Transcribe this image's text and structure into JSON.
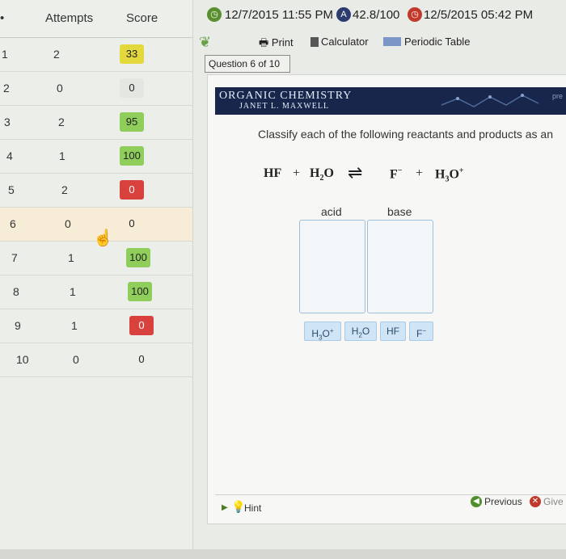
{
  "scores": {
    "headers": {
      "attempts": "Attempts",
      "score": "Score"
    },
    "rows": [
      {
        "num": "1",
        "attempts": "2",
        "score": "33",
        "status": "yellow"
      },
      {
        "num": "2",
        "attempts": "0",
        "score": "0",
        "status": "gray"
      },
      {
        "num": "3",
        "attempts": "2",
        "score": "95",
        "status": "green"
      },
      {
        "num": "4",
        "attempts": "1",
        "score": "100",
        "status": "green"
      },
      {
        "num": "5",
        "attempts": "2",
        "score": "0",
        "status": "red"
      },
      {
        "num": "6",
        "attempts": "0",
        "score": "0",
        "status": "gray"
      },
      {
        "num": "7",
        "attempts": "1",
        "score": "100",
        "status": "green"
      },
      {
        "num": "8",
        "attempts": "1",
        "score": "100",
        "status": "green"
      },
      {
        "num": "9",
        "attempts": "1",
        "score": "0",
        "status": "red"
      },
      {
        "num": "10",
        "attempts": "0",
        "score": "0",
        "status": "gray"
      }
    ]
  },
  "topbar": {
    "due_date": "12/7/2015 11:55 PM",
    "grade": "42.8/100",
    "late_date": "12/5/2015 05:42 PM"
  },
  "tools": {
    "print": "Print",
    "calculator": "Calculator",
    "periodic_table": "Periodic Table"
  },
  "question": {
    "label": "Question 6 of 10",
    "prompt": "Classify each of the following reactants and products as an"
  },
  "banner": {
    "title": "Organic Chemistry",
    "author": "Janet L. Maxwell",
    "corner": "pre"
  },
  "equation": {
    "r1": "HF",
    "plus1": "+",
    "r2": "H",
    "r2_sub": "2",
    "r2_tail": "O",
    "p1": "F",
    "p1_sup": "−",
    "plus2": "+",
    "p2": "H",
    "p2_sub": "3",
    "p2_tail": "O",
    "p2_sup": "+"
  },
  "bins": {
    "acid": "acid",
    "base": "base"
  },
  "chips": [
    {
      "main": "H",
      "sub": "3",
      "tail": "O",
      "sup": "+"
    },
    {
      "main": "H",
      "sub": "2",
      "tail": "O",
      "sup": ""
    },
    {
      "main": "HF",
      "sub": "",
      "tail": "",
      "sup": ""
    },
    {
      "main": "F",
      "sub": "",
      "tail": "",
      "sup": "−"
    }
  ],
  "footer": {
    "hint": "Hint",
    "previous": "Previous",
    "give_up": "Give"
  },
  "colors": {
    "yellow": "#e3d93c",
    "green": "#8fce5a",
    "red": "#d9413c",
    "banner": "#17264a"
  }
}
